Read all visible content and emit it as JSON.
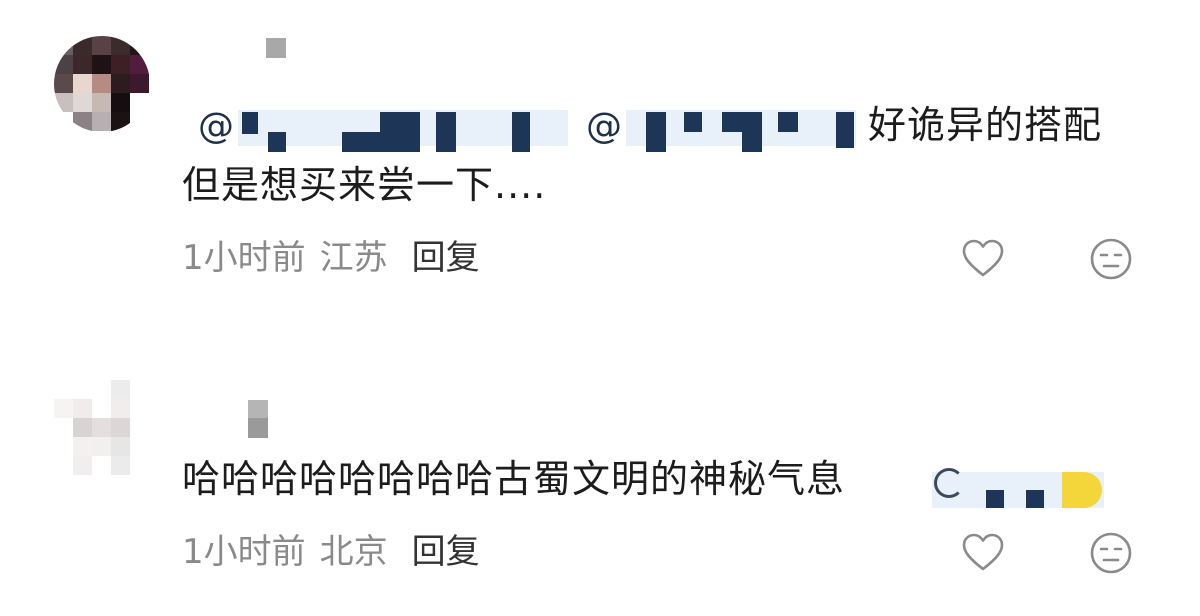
{
  "comments": [
    {
      "mentions": [
        "@",
        "@"
      ],
      "text_line1": "好诡异的搭配",
      "text_line2": "但是想买来尝一下....",
      "time": "1小时前",
      "location": "江苏",
      "reply_label": "回复"
    },
    {
      "text_line1": "哈哈哈哈哈哈哈哈古蜀文明的神秘气息",
      "time": "1小时前",
      "location": "北京",
      "reply_label": "回复"
    }
  ],
  "icons": {
    "like": "heart-outline-icon",
    "dislike": "meh-face-icon"
  },
  "colors": {
    "text": "#1c1c1c",
    "meta": "#8a8a8a",
    "mention": "#1f3149",
    "icon": "#8a8a8a"
  }
}
